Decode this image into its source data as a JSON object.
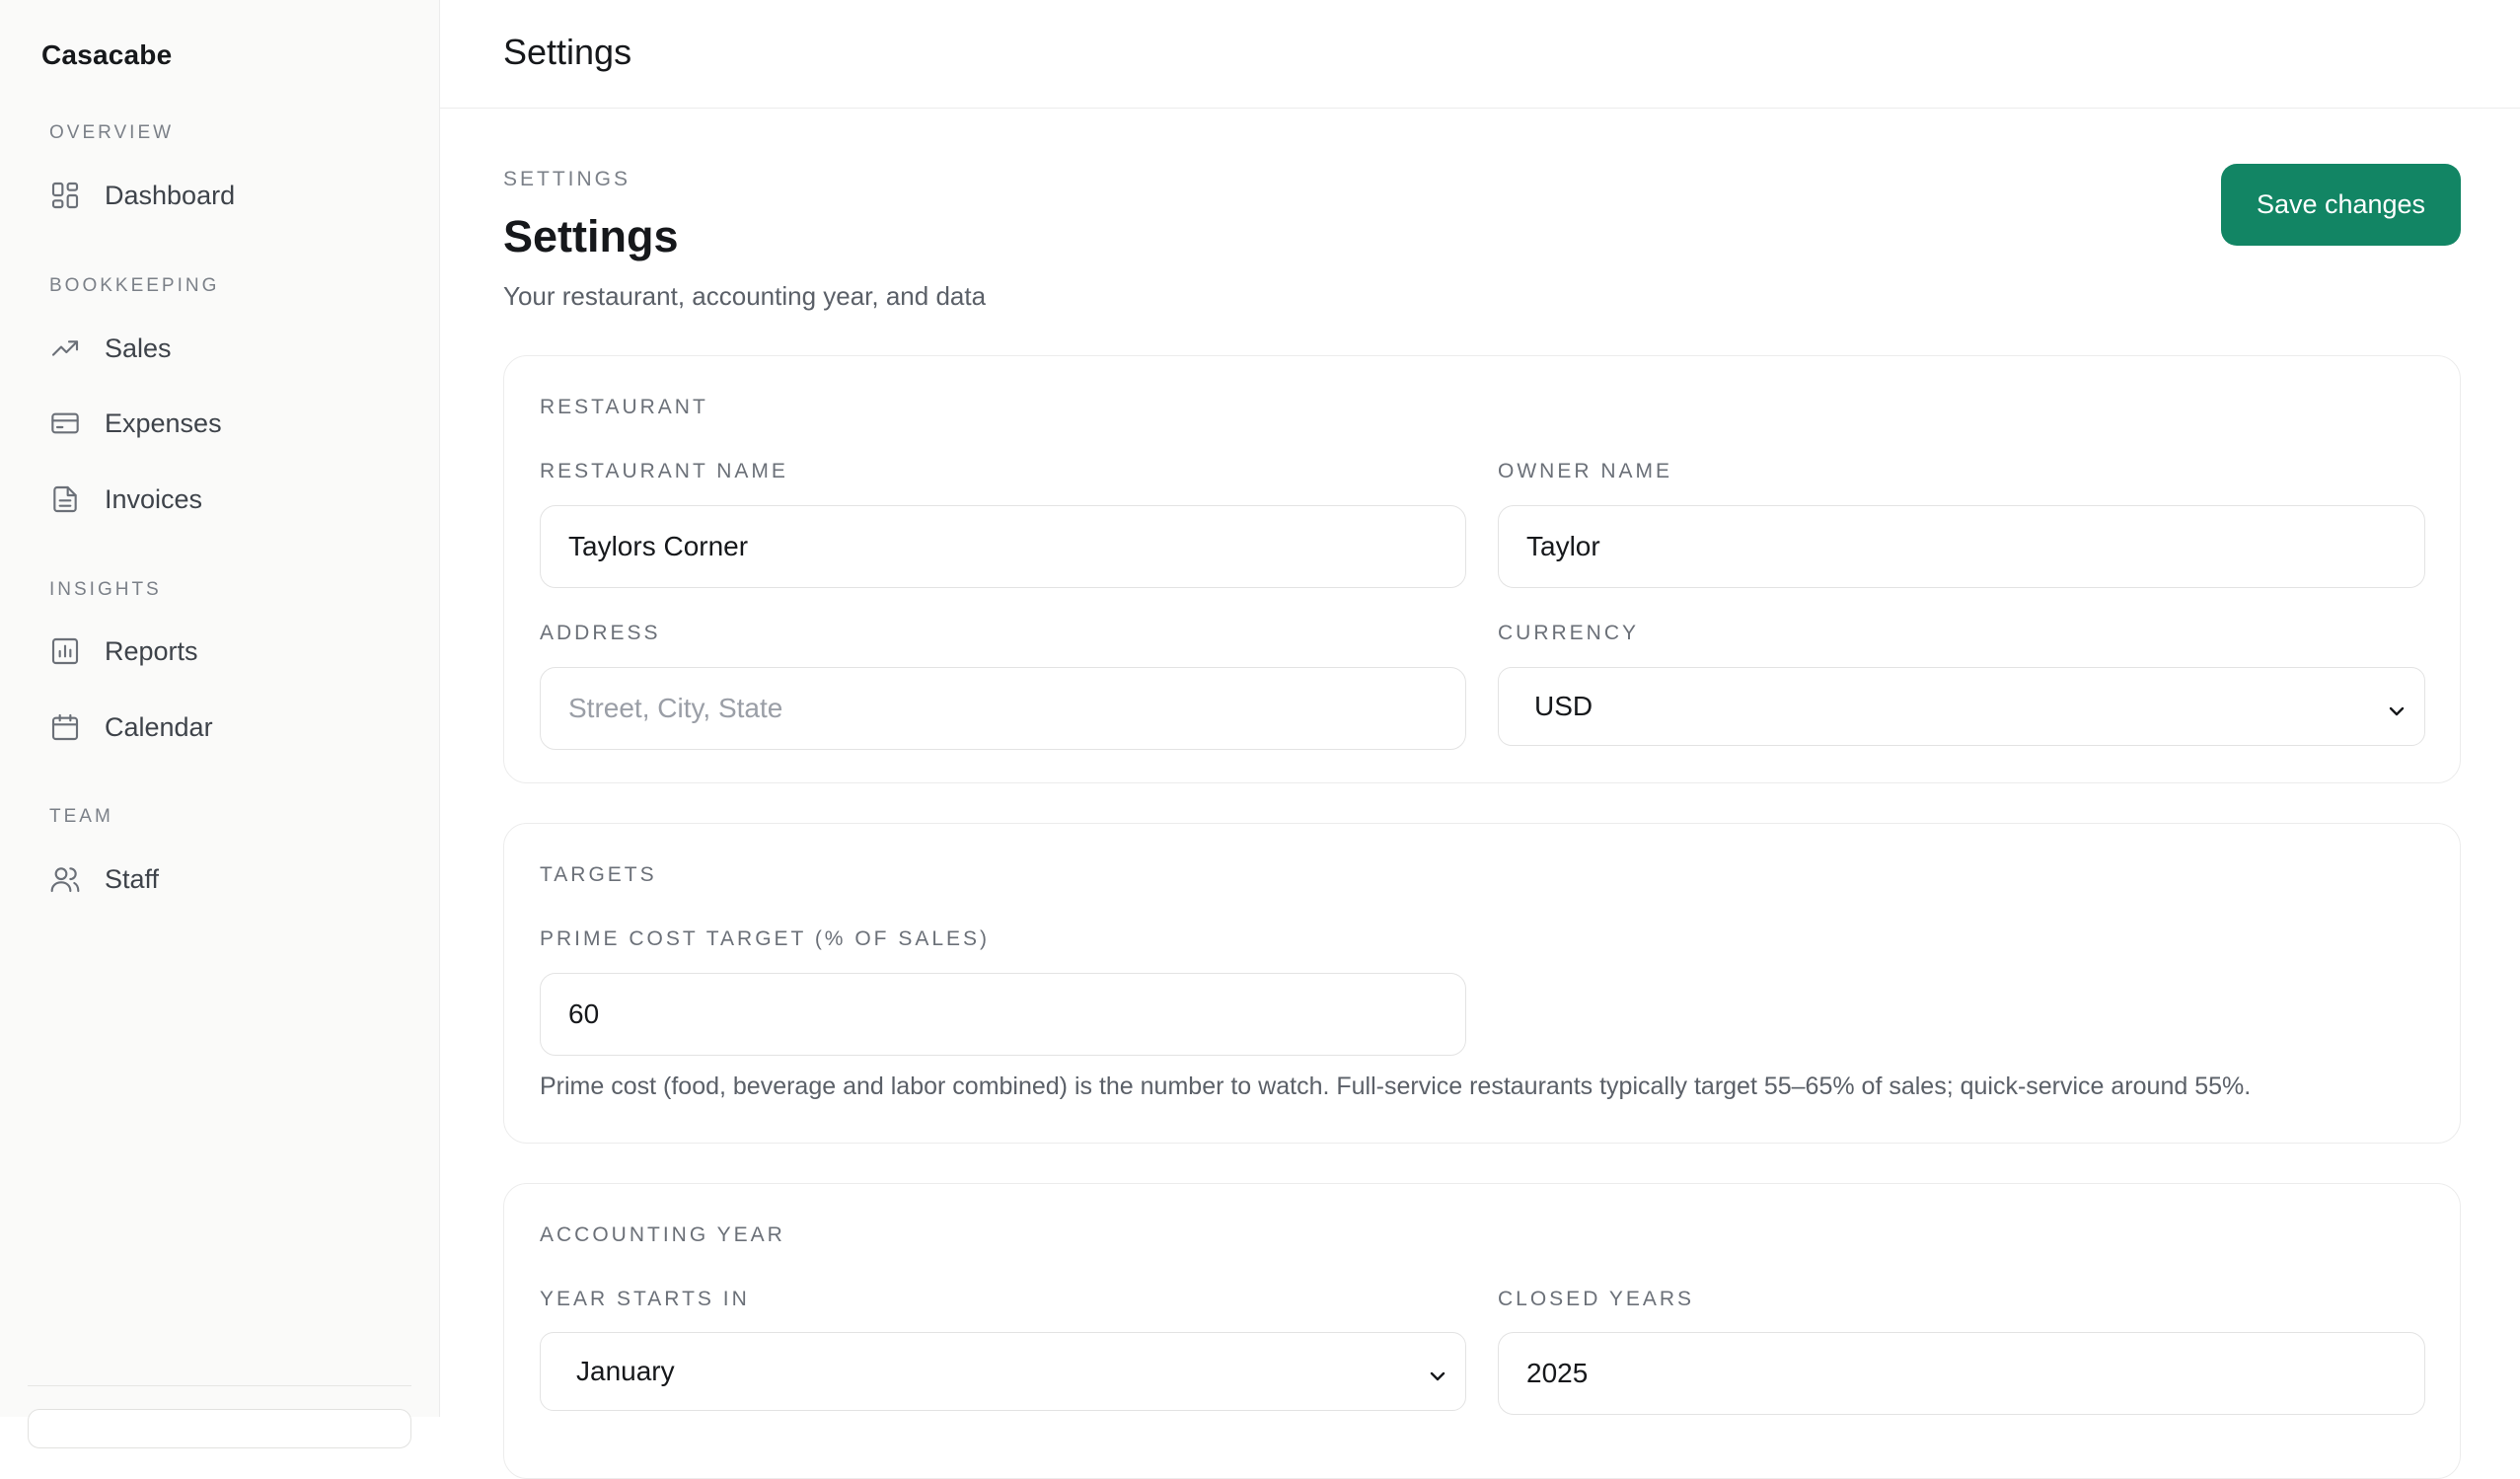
{
  "app": {
    "brand": "Casacabe"
  },
  "sidebar": {
    "sections": [
      {
        "title": "OVERVIEW"
      },
      {
        "title": "BOOKKEEPING"
      },
      {
        "title": "INSIGHTS"
      },
      {
        "title": "TEAM"
      }
    ],
    "items": [
      {
        "label": "Dashboard",
        "icon": "dashboard-icon"
      },
      {
        "label": "Sales",
        "icon": "trending-up-icon"
      },
      {
        "label": "Expenses",
        "icon": "credit-card-icon"
      },
      {
        "label": "Invoices",
        "icon": "document-icon"
      },
      {
        "label": "Reports",
        "icon": "bar-chart-icon"
      },
      {
        "label": "Calendar",
        "icon": "calendar-icon"
      },
      {
        "label": "Staff",
        "icon": "users-icon"
      }
    ]
  },
  "header": {
    "title": "Settings"
  },
  "page": {
    "eyebrow": "SETTINGS",
    "title": "Settings",
    "subtitle": "Your restaurant, accounting year, and data",
    "save_label": "Save changes"
  },
  "restaurant": {
    "section_title": "RESTAURANT",
    "name_label": "RESTAURANT NAME",
    "name_value": "Taylors Corner",
    "owner_label": "OWNER NAME",
    "owner_value": "Taylor",
    "address_label": "ADDRESS",
    "address_placeholder": "Street, City, State",
    "currency_label": "CURRENCY",
    "currency_value": "USD"
  },
  "targets": {
    "section_title": "TARGETS",
    "prime_label": "PRIME COST TARGET (% OF SALES)",
    "prime_value": "60",
    "help": "Prime cost (food, beverage and labor combined) is the number to watch. Full-service restaurants typically target 55–65% of sales; quick-service around 55%."
  },
  "accounting": {
    "section_title": "ACCOUNTING YEAR",
    "start_label": "YEAR STARTS IN",
    "start_value": "January",
    "closed_label": "CLOSED YEARS",
    "closed_value": "2025"
  },
  "colors": {
    "accent": "#128564",
    "sidebar_bg": "#fafaf9"
  }
}
